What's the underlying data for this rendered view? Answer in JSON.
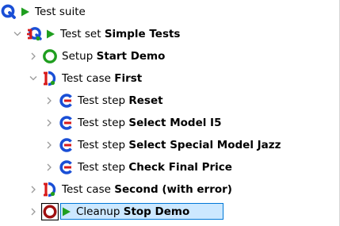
{
  "tree": {
    "items": [
      {
        "level": 0,
        "expander": "none",
        "icon": "test-suite-icon",
        "running": true,
        "prefix": "Test suite",
        "name": ""
      },
      {
        "level": 1,
        "expander": "expanded",
        "icon": "test-set-icon",
        "running": true,
        "prefix": "Test set",
        "name": "Simple Tests"
      },
      {
        "level": 2,
        "expander": "collapsed",
        "icon": "setup-icon",
        "running": false,
        "prefix": "Setup",
        "name": "Start Demo"
      },
      {
        "level": 2,
        "expander": "expanded",
        "icon": "test-case-icon",
        "running": false,
        "prefix": "Test case",
        "name": "First"
      },
      {
        "level": 3,
        "expander": "collapsed",
        "icon": "test-step-icon",
        "running": false,
        "prefix": "Test step",
        "name": "Reset"
      },
      {
        "level": 3,
        "expander": "collapsed",
        "icon": "test-step-icon",
        "running": false,
        "prefix": "Test step",
        "name": "Select Model I5"
      },
      {
        "level": 3,
        "expander": "collapsed",
        "icon": "test-step-icon",
        "running": false,
        "prefix": "Test step",
        "name": "Select Special Model Jazz"
      },
      {
        "level": 3,
        "expander": "collapsed",
        "icon": "test-step-icon",
        "running": false,
        "prefix": "Test step",
        "name": "Check Final Price"
      },
      {
        "level": 2,
        "expander": "collapsed",
        "icon": "test-case-icon",
        "running": false,
        "prefix": "Test case",
        "name": "Second (with error)"
      },
      {
        "level": 2,
        "expander": "collapsed",
        "icon": "cleanup-icon",
        "running": true,
        "prefix": "Cleanup",
        "name": "Stop Demo",
        "selected": true
      }
    ]
  },
  "colors": {
    "blue": "#1a4fd6",
    "green": "#1f9e1f",
    "red": "#d81b1b",
    "dark_red": "#a01010",
    "selection_bg": "#cce8ff",
    "selection_border": "#0078d7",
    "expander": "#9a9a9a"
  }
}
